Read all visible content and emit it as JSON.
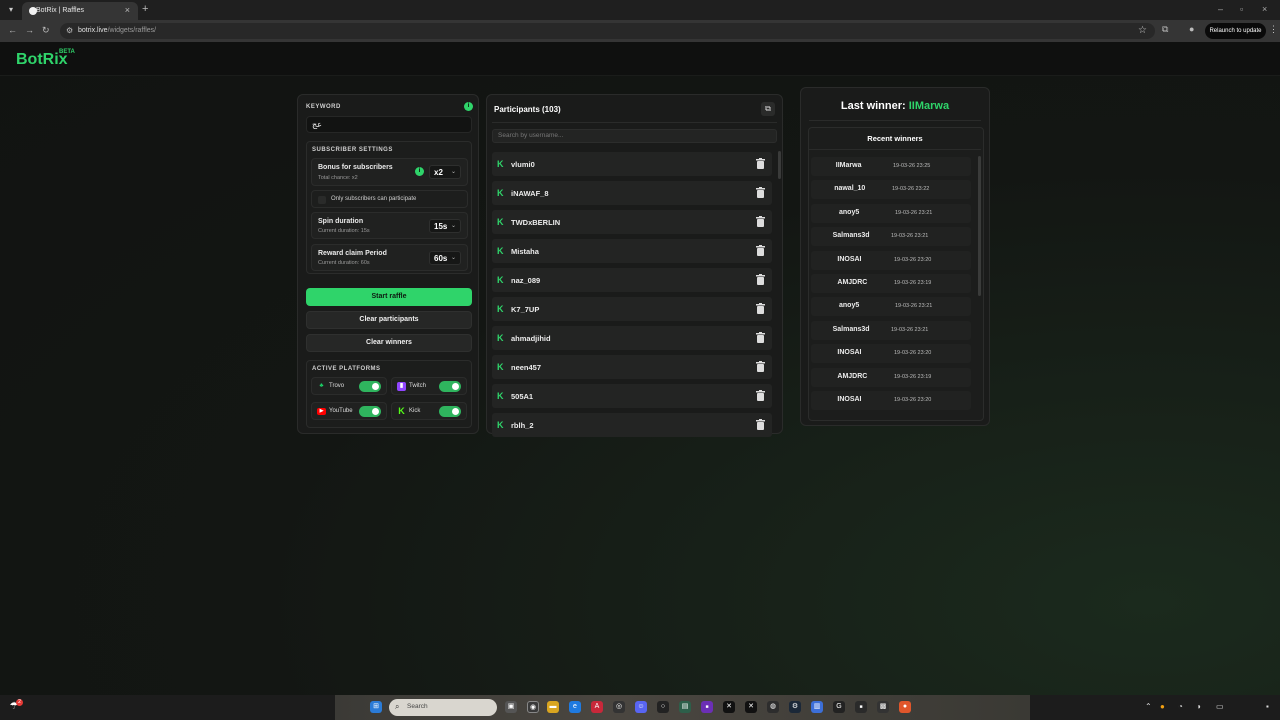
{
  "browser": {
    "menu_icon": "chevron-down-icon",
    "tab_title": "BotRix | Raffles",
    "url_host": "botrix.live",
    "url_path": "/widgets/raffles/",
    "relaunch_label": "Relaunch to update"
  },
  "app": {
    "logo": "BotRix",
    "logo_badge": "BETA"
  },
  "settings": {
    "keyword_title": "KEYWORD",
    "keyword_value": "عج",
    "subscriber_title": "SUBSCRIBER SETTINGS",
    "bonus_label": "Bonus for subscribers",
    "bonus_sub": "Total chance: x2",
    "bonus_value": "x2",
    "only_subs_label": "Only subscribers can participate",
    "spin_label": "Spin duration",
    "spin_sub": "Current duration: 15s",
    "spin_value": "15s",
    "claim_label": "Reward claim Period",
    "claim_sub": "Current duration: 60s",
    "claim_value": "60s",
    "start_button": "Start raffle",
    "clear_participants_button": "Clear participants",
    "clear_winners_button": "Clear winners",
    "platforms_title": "ACTIVE PLATFORMS",
    "platforms": [
      {
        "name": "Trovo",
        "enabled": true,
        "color": "#1bd96a"
      },
      {
        "name": "Twitch",
        "enabled": true,
        "color": "#9146ff"
      },
      {
        "name": "YouTube",
        "enabled": true,
        "color": "#ff0000"
      },
      {
        "name": "Kick",
        "enabled": true,
        "color": "#53fc18"
      }
    ]
  },
  "participants": {
    "title": "Participants (103)",
    "search_placeholder": "Search by username...",
    "items": [
      "vlumi0",
      "iNAWAF_8",
      "TWDxBERLIN",
      "Mistaha",
      "naz_089",
      "K7_7UP",
      "ahmadjihid",
      "neen457",
      "505A1",
      "rblh_2"
    ]
  },
  "winners": {
    "last_label": "Last winner:",
    "last_name": "IIMarwa",
    "recent_title": "Recent winners",
    "items": [
      {
        "name": "IIMarwa",
        "time": "19-03-26 23:25"
      },
      {
        "name": "nawal_10",
        "time": "19-03-26 23:22"
      },
      {
        "name": "anoy5",
        "time": "19-03-26 23:21"
      },
      {
        "name": "Salmans3d",
        "time": "19-03-26 23:21"
      },
      {
        "name": "INOSAI",
        "time": "19-03-26 23:20"
      },
      {
        "name": "AMJDRC",
        "time": "19-03-26 23:19"
      },
      {
        "name": "anoy5",
        "time": "19-03-26 23:21"
      },
      {
        "name": "Salmans3d",
        "time": "19-03-26 23:21"
      },
      {
        "name": "INOSAI",
        "time": "19-03-26 23:20"
      },
      {
        "name": "AMJDRC",
        "time": "19-03-26 23:19"
      },
      {
        "name": "INOSAI",
        "time": "19-03-26 23:20"
      }
    ]
  },
  "taskbar": {
    "search_placeholder": "Search",
    "badge_count": "2"
  },
  "colors": {
    "accent": "#2fd46a",
    "background": "#111311"
  }
}
